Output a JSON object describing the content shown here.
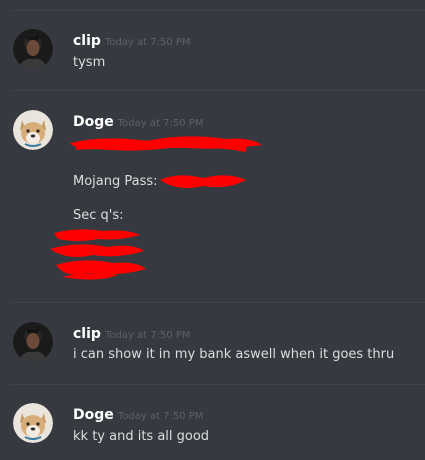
{
  "messages": [
    {
      "author": "clip",
      "timestamp": "Today at 7:50 PM",
      "lines": [
        "tysm"
      ]
    },
    {
      "author": "Doge",
      "timestamp": "Today at 7:50 PM",
      "lines": [
        "Mojang Pass:",
        "Sec q's:"
      ],
      "redaction_color": "#ff0000"
    },
    {
      "author": "clip",
      "timestamp": "Today at 7:50 PM",
      "lines": [
        "i can show it in my bank aswell when it goes thru"
      ]
    },
    {
      "author": "Doge",
      "timestamp": "Today at 7:50 PM",
      "lines": [
        "kk ty and its all good"
      ]
    }
  ],
  "avatars": {
    "clip": "dark-profile-photo-avatar",
    "Doge": "shiba-dog-avatar"
  },
  "colors": {
    "background": "#36393f",
    "divider": "#40434a",
    "username": "#ffffff",
    "timestamp": "#5e6168",
    "message_text": "#dcddde"
  }
}
